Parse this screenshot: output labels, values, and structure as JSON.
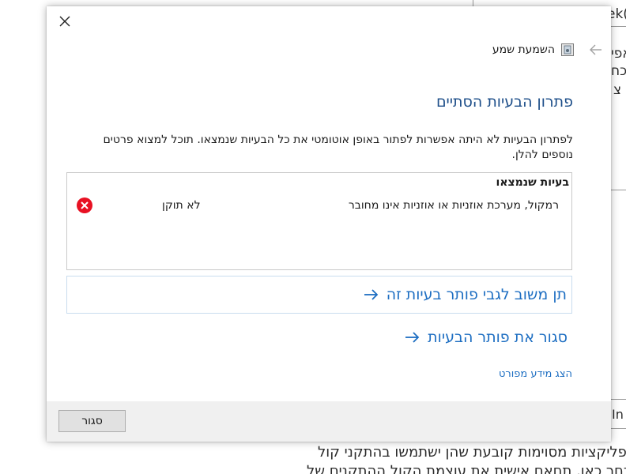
{
  "background": {
    "frag_top_right": "ek(",
    "frag_row1": "אפי",
    "frag_row2": "כח",
    "frag_row3": "צ",
    "frag_mid": "In",
    "frag_bottom1": "אפליקציות מסוימות קובעת שהן ישתמשו בהתקני קול",
    "frag_bottom2": "בחר כאן, תחאם אישית את עוצמת הקול ההתקנים של"
  },
  "dialog": {
    "header_label": "השמעת שמע",
    "title": "פתרון הבעיות הסתיים",
    "description": "לפתרון הבעיות לא היתה אפשרות לפתור באופן אוטומטי את כל הבעיות שנמצאו. תוכל למצוא פרטים נוספים להלן.",
    "found_heading": "בעיות שנמצאו",
    "problems": [
      {
        "name": "רמקול, מערכת אוזניות או אוזניות אינו מחובר",
        "status": "לא תוקן"
      }
    ],
    "feedback_link": "תן משוב לגבי פותר בעיות זה",
    "close_troubleshooter_link": "סגור את פותר הבעיות",
    "detail_link": "הצג מידע מפורט",
    "close_button": "סגור"
  },
  "colors": {
    "accent_link": "#1d6ec2",
    "title": "#1d4e89",
    "error_red": "#e81123"
  }
}
